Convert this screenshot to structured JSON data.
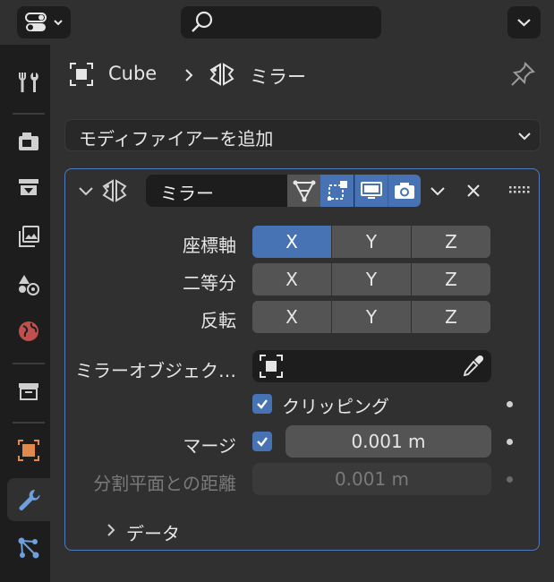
{
  "breadcrumb": {
    "object": "Cube",
    "modifier": "ミラー"
  },
  "add_modifier": {
    "label": "モディファイアーを追加"
  },
  "modifier": {
    "name": "ミラー",
    "axis": {
      "label": "座標軸",
      "x": "X",
      "y": "Y",
      "z": "Z",
      "active": [
        "X"
      ]
    },
    "bisect": {
      "label": "二等分",
      "x": "X",
      "y": "Y",
      "z": "Z"
    },
    "flip": {
      "label": "反転",
      "x": "X",
      "y": "Y",
      "z": "Z"
    },
    "mirror_object": {
      "label": "ミラーオブジェク…",
      "value": ""
    },
    "clipping": {
      "label": "クリッピング",
      "checked": true
    },
    "merge": {
      "label": "マージ",
      "checked": true,
      "value": "0.001 m"
    },
    "bisect_distance": {
      "label": "分割平面との距離",
      "value": "0.001 m"
    },
    "data_section": {
      "label": "データ",
      "expanded": false
    }
  },
  "colors": {
    "accent": "#4772b3",
    "panel_border": "#4f7bbd",
    "background": "#303030",
    "field": "#1d1d1d",
    "button": "#545454"
  }
}
